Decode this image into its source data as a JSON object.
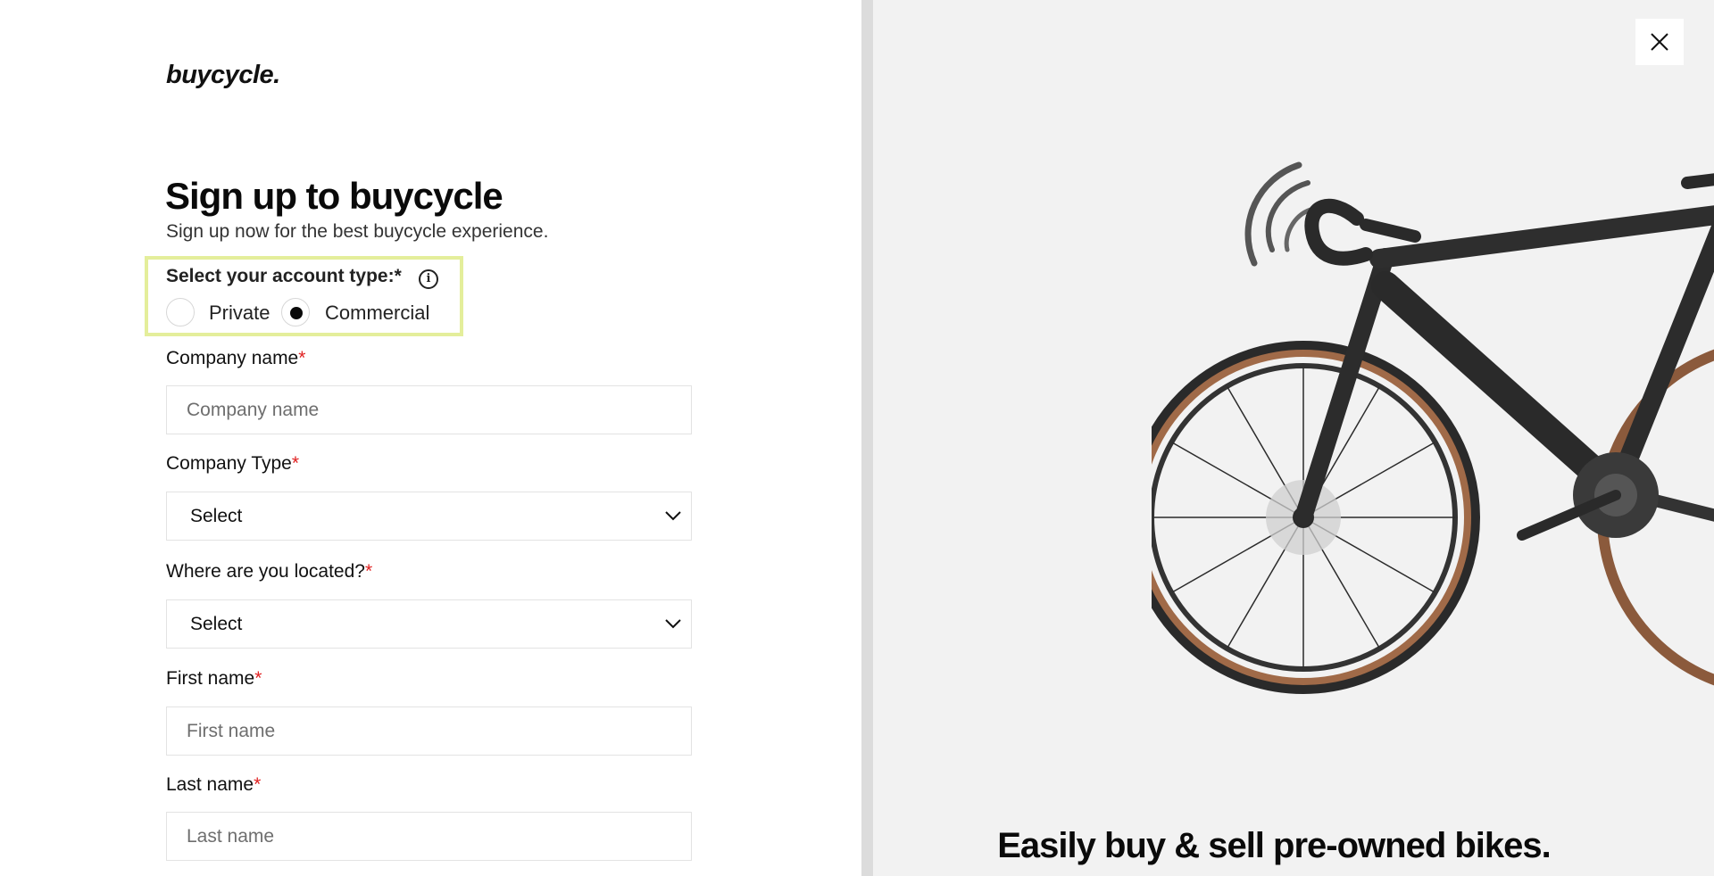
{
  "brand": {
    "logo_text": "buycycle."
  },
  "form": {
    "title": "Sign up to buycycle",
    "subtitle": "Sign up now for the best buycycle experience.",
    "account_type": {
      "label": "Select your account type:*",
      "options": [
        {
          "label": "Private",
          "selected": false
        },
        {
          "label": "Commercial",
          "selected": true
        }
      ]
    },
    "company_name": {
      "label": "Company name",
      "required_mark": "*",
      "placeholder": "Company name"
    },
    "company_type": {
      "label": "Company Type",
      "required_mark": "*",
      "value": "Select"
    },
    "location": {
      "label": "Where are you located?",
      "required_mark": "*",
      "value": "Select"
    },
    "first_name": {
      "label": "First name",
      "required_mark": "*",
      "placeholder": "First name"
    },
    "last_name": {
      "label": "Last name",
      "required_mark": "*",
      "placeholder": "Last name"
    }
  },
  "promo": {
    "tagline": "Easily buy & sell pre-owned bikes."
  },
  "colors": {
    "highlight_border": "#e4ee9b",
    "required": "#e02020",
    "panel_bg": "#f2f2f2"
  },
  "icons": {
    "info": "info-icon",
    "close": "close-icon",
    "chevron": "chevron-down-icon"
  }
}
